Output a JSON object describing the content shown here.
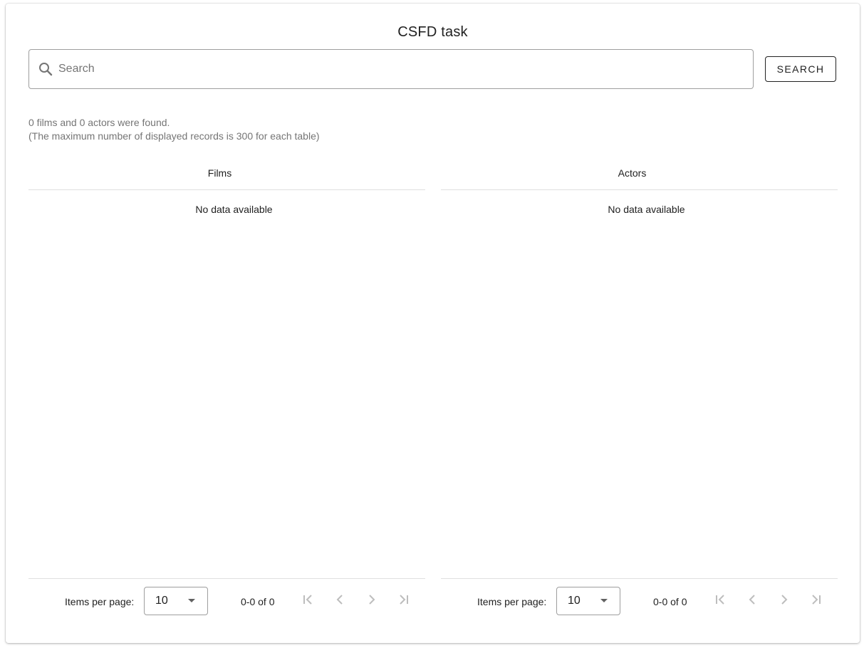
{
  "header": {
    "title": "CSFD task"
  },
  "search": {
    "placeholder": "Search",
    "value": "",
    "button_label": "SEARCH",
    "icon": "search-icon"
  },
  "results": {
    "summary": "0 films and 0 actors were found.",
    "note": "(The maximum number of displayed records is 300 for each table)"
  },
  "tables": {
    "films": {
      "header": "Films",
      "empty_message": "No data available",
      "paginator": {
        "items_per_page_label": "Items per page:",
        "page_size": "10",
        "range_label": "0-0 of 0"
      }
    },
    "actors": {
      "header": "Actors",
      "empty_message": "No data available",
      "paginator": {
        "items_per_page_label": "Items per page:",
        "page_size": "10",
        "range_label": "0-0 of 0"
      }
    }
  },
  "colors": {
    "text_primary": "#212121",
    "text_secondary": "#757575",
    "divider": "#e0e0e0",
    "disabled_icon": "#bdbdbd"
  }
}
